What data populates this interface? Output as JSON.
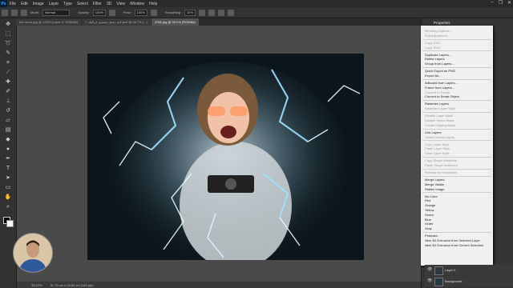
{
  "menubar": {
    "logo": "Ps",
    "items": [
      "File",
      "Edit",
      "Image",
      "Layer",
      "Type",
      "Select",
      "Filter",
      "3D",
      "View",
      "Window",
      "Help"
    ],
    "window_buttons": [
      "–",
      "❐",
      "✕"
    ]
  },
  "options": {
    "mode_label": "Mode:",
    "mode_value": "Normal",
    "opacity_label": "Opacity:",
    "opacity_value": "100%",
    "flow_label": "Flow:",
    "flow_value": "100%",
    "smoothing_label": "Smoothing:",
    "smoothing_value": "10%"
  },
  "tabs": [
    {
      "label": "the result.jpg @ 125% (Layer 0, RGB/8#)"
    },
    {
      "label": "7-كيف تعمل تصميم جرافيك.psd @ 66.7% (...)"
    },
    {
      "label": "4766.jpg @ 33.2% (RGB/8#)"
    }
  ],
  "status": {
    "zoom": "33.22%",
    "doc": "31.75 cm x 23.81 cm (180 ppi)"
  },
  "panel": {
    "title": "Properties"
  },
  "menu": {
    "items": [
      {
        "label": "Blending Options...",
        "disabled": true
      },
      {
        "label": "Edit Adjustment...",
        "disabled": true
      },
      {
        "label": "Copy CSS",
        "disabled": true
      },
      {
        "label": "Copy SVG",
        "disabled": true
      },
      {
        "label": "Duplicate Layers...",
        "disabled": false
      },
      {
        "label": "Delete Layers",
        "disabled": false
      },
      {
        "label": "Group from Layers...",
        "disabled": false
      },
      {
        "label": "Quick Export as PNG",
        "disabled": false
      },
      {
        "label": "Export As...",
        "disabled": false
      },
      {
        "label": "Artboard from Layers...",
        "disabled": false
      },
      {
        "label": "Frame from Layers...",
        "disabled": false
      },
      {
        "label": "Convert to Frame",
        "disabled": true
      },
      {
        "label": "Convert to Smart Object",
        "disabled": false
      },
      {
        "label": "Rasterize Layers",
        "disabled": false
      },
      {
        "label": "Rasterize Layer Style",
        "disabled": true
      },
      {
        "label": "Disable Layer Mask",
        "disabled": true
      },
      {
        "label": "Disable Vector Mask",
        "disabled": true
      },
      {
        "label": "Create Clipping Mask",
        "disabled": true
      },
      {
        "label": "Link Layers",
        "disabled": false
      },
      {
        "label": "Select Linked Layers",
        "disabled": true
      },
      {
        "label": "Copy Layer Style",
        "disabled": true
      },
      {
        "label": "Paste Layer Style",
        "disabled": true
      },
      {
        "label": "Clear Layer Style",
        "disabled": true
      },
      {
        "label": "Copy Shape Attributes",
        "disabled": true
      },
      {
        "label": "Paste Shape Attributes",
        "disabled": true
      },
      {
        "label": "Release from Isolation",
        "disabled": true
      },
      {
        "label": "Merge Layers",
        "disabled": false
      },
      {
        "label": "Merge Visible",
        "disabled": false
      },
      {
        "label": "Flatten Image",
        "disabled": false
      },
      {
        "label": "No Color",
        "disabled": false
      },
      {
        "label": "Red",
        "disabled": false
      },
      {
        "label": "Orange",
        "disabled": false
      },
      {
        "label": "Yellow",
        "disabled": false
      },
      {
        "label": "Green",
        "disabled": false
      },
      {
        "label": "Blue",
        "disabled": false
      },
      {
        "label": "Violet",
        "disabled": false
      },
      {
        "label": "Gray",
        "disabled": false
      },
      {
        "label": "Postcard",
        "disabled": false
      },
      {
        "label": "New 3D Extrusion from Selected Layer",
        "disabled": false
      },
      {
        "label": "New 3D Extrusion from Current Selection",
        "disabled": false
      }
    ]
  },
  "layers": [
    {
      "name": "Background"
    },
    {
      "name": "Layer 0"
    }
  ],
  "icons": {
    "tools": [
      "move-icon",
      "marquee-icon",
      "lasso-icon",
      "quick-select-icon",
      "crop-icon",
      "eyedropper-icon",
      "healing-icon",
      "brush-icon",
      "stamp-icon",
      "history-brush-icon",
      "eraser-icon",
      "gradient-icon",
      "blur-icon",
      "dodge-icon",
      "pen-icon",
      "type-icon",
      "path-select-icon",
      "shape-icon",
      "hand-icon",
      "zoom-icon"
    ]
  }
}
